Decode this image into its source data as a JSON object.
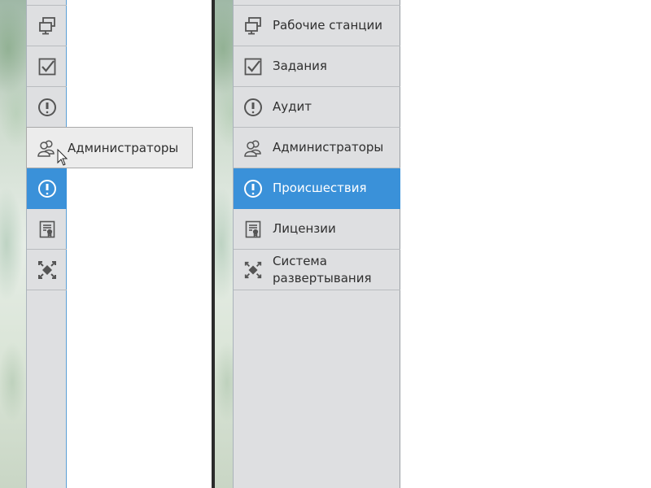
{
  "collapsed_nav": {
    "items": [
      {
        "icon": "workstations-icon"
      },
      {
        "icon": "tasks-icon"
      },
      {
        "icon": "audit-icon"
      },
      {
        "icon": "administrators-icon"
      },
      {
        "icon": "incidents-icon",
        "active": true
      },
      {
        "icon": "licenses-icon"
      },
      {
        "icon": "deployment-system-icon"
      }
    ],
    "tooltip": {
      "label": "Администраторы",
      "icon": "administrators-icon"
    }
  },
  "expanded_nav": {
    "items": [
      {
        "label": "Рабочие станции",
        "icon": "workstations-icon"
      },
      {
        "label": "Задания",
        "icon": "tasks-icon"
      },
      {
        "label": "Аудит",
        "icon": "audit-icon"
      },
      {
        "label": "Администраторы",
        "icon": "administrators-icon"
      },
      {
        "label": "Происшествия",
        "icon": "incidents-icon",
        "active": true
      },
      {
        "label": "Лицензии",
        "icon": "licenses-icon"
      },
      {
        "label": "Система развертывания",
        "icon": "deployment-system-icon"
      }
    ]
  },
  "colors": {
    "active": "#3a91d9",
    "panel": "#dedfe1",
    "text": "#2f2f2f"
  }
}
